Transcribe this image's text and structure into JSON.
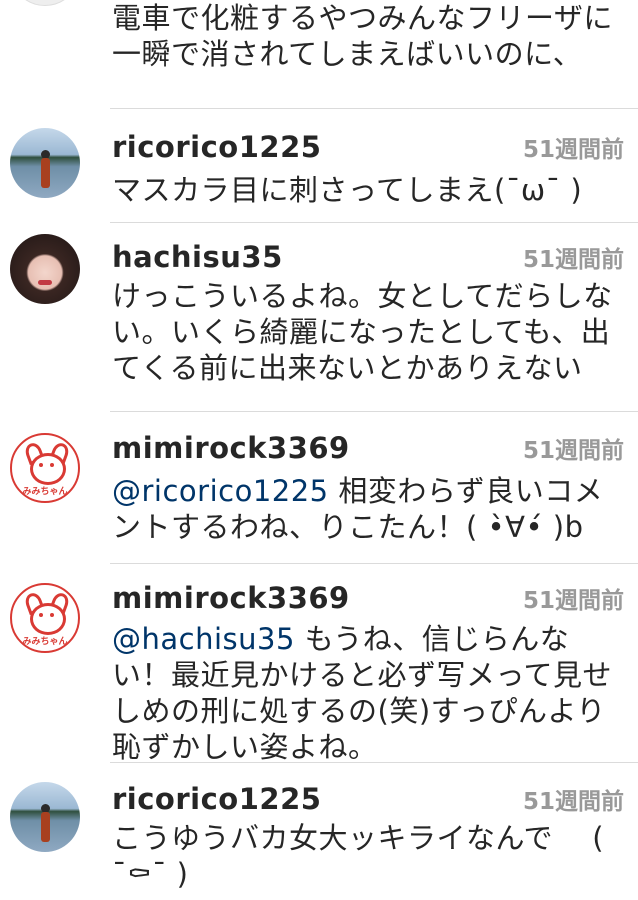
{
  "top_comment": {
    "text": "電車で化粧するやつみんなフリーザに一瞬で消されてしまえばいいのに、"
  },
  "comments": [
    {
      "username": "ricorico1225",
      "time": "51週間前",
      "text": "マスカラ目に刺さってしまえ(¯ω¯ )",
      "avatar": "lake-photo-avatar"
    },
    {
      "username": "hachisu35",
      "time": "51週間前",
      "text": "けっこういるよね。女としてだらしない。いくら綺麗になったとしても、出てくる前に出来ないとかありえない",
      "avatar": "girl-photo-avatar"
    },
    {
      "username": "mimirock3369",
      "time": "51週間前",
      "mention": "@ricorico1225",
      "text": "相変わらず良いコメントするわね、りこたん！( •̀∀•́ )b",
      "avatar": "mimi-chan-logo-avatar"
    },
    {
      "username": "mimirock3369",
      "time": "51週間前",
      "mention": "@hachisu35",
      "text": "もうね、信じらんない！最近見かけると必ず写メって見せしめの刑に処するの(笑)すっぴんより恥ずかしい姿よね。",
      "avatar": "mimi-chan-logo-avatar"
    },
    {
      "username": "ricorico1225",
      "time": "51週間前",
      "text": "こうゆうバカ女大ッキライなんで　 ( ¯⚰¯ )",
      "avatar": "lake-photo-avatar"
    }
  ],
  "mimi_logo_text": "みみちゃん",
  "colors": {
    "username": "#262626",
    "timestamp": "#999999",
    "mention": "#003569",
    "divider": "#dbdbdb",
    "mimi_red": "#d93a34"
  }
}
